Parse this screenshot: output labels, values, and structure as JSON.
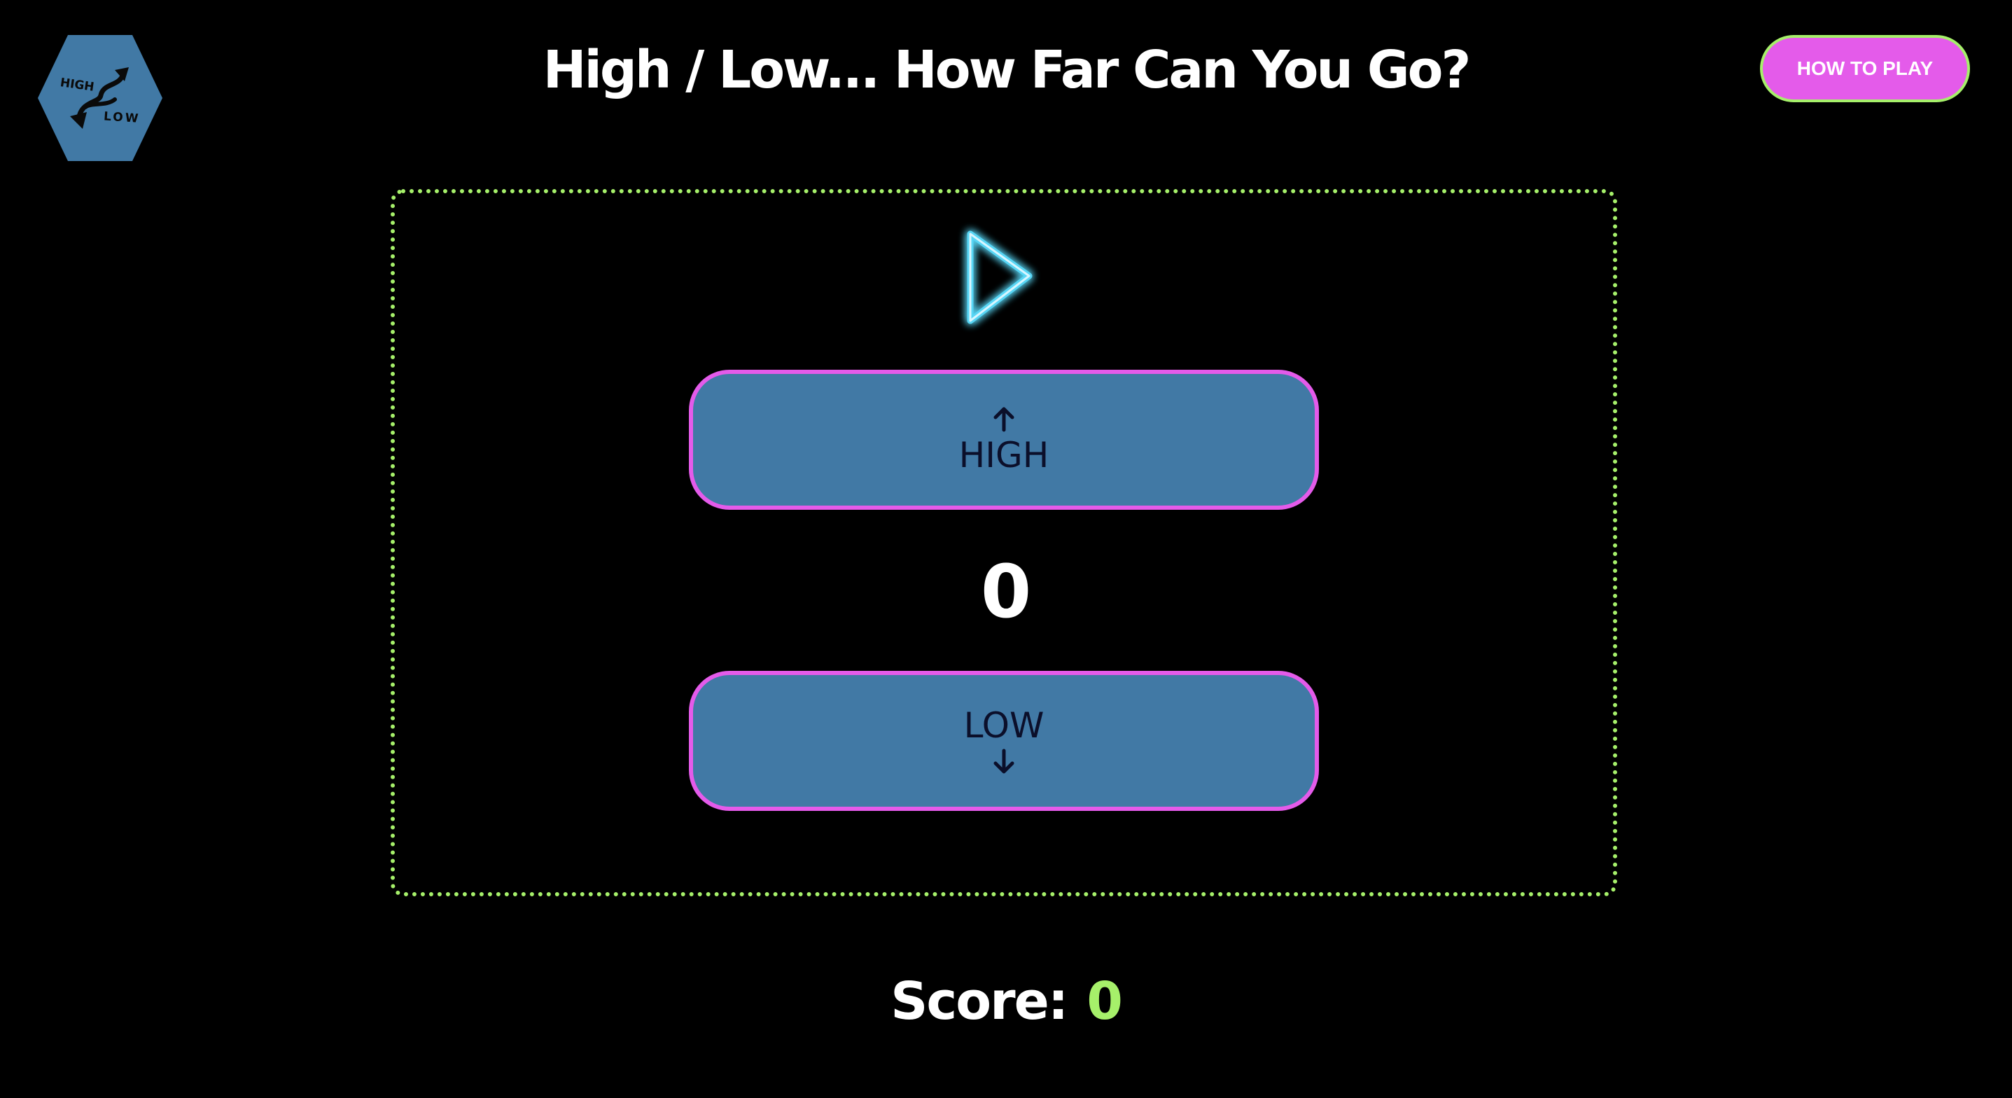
{
  "header": {
    "title": "High / Low... How Far Can You Go?",
    "how_to_play_label": "HOW TO PLAY"
  },
  "logo": {
    "top_text": "HIGH",
    "bottom_text": "LOW",
    "color": "#4179a5"
  },
  "game": {
    "play_icon": "play-triangle-icon",
    "high_button": {
      "label": "HIGH",
      "icon": "arrow-up-icon"
    },
    "current_number": "0",
    "low_button": {
      "label": "LOW",
      "icon": "arrow-down-icon"
    }
  },
  "score": {
    "label": "Score:",
    "value": "0"
  },
  "colors": {
    "background": "#000000",
    "accent_green": "#a6f06a",
    "accent_pink": "#e45bea",
    "button_blue": "#4179a5",
    "neon_cyan": "#58d6f5"
  }
}
